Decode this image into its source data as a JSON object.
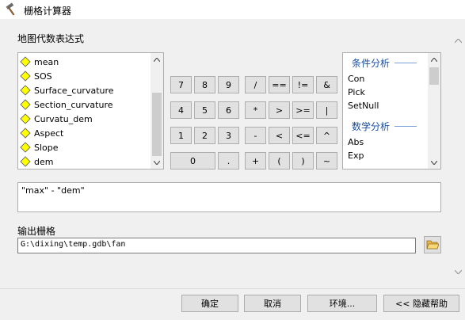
{
  "window": {
    "title": "栅格计算器",
    "icon": "hammer-icon"
  },
  "map_algebra": {
    "label": "地图代数表达式",
    "layers": [
      {
        "name": "mean",
        "icon": "raster-layer-icon"
      },
      {
        "name": "SOS",
        "icon": "raster-layer-icon"
      },
      {
        "name": "Surface_curvature",
        "icon": "raster-layer-icon"
      },
      {
        "name": "Section_curvature",
        "icon": "raster-layer-icon"
      },
      {
        "name": "Curvatu_dem",
        "icon": "raster-layer-icon"
      },
      {
        "name": "Aspect",
        "icon": "raster-layer-icon"
      },
      {
        "name": "Slope",
        "icon": "raster-layer-icon"
      },
      {
        "name": "dem",
        "icon": "raster-layer-icon"
      }
    ],
    "keypad": {
      "row1": [
        "7",
        "8",
        "9",
        "/",
        "==",
        "!=",
        "&"
      ],
      "row2": [
        "4",
        "5",
        "6",
        "*",
        ">",
        ">=",
        "|"
      ],
      "row3": [
        "1",
        "2",
        "3",
        "-",
        "<",
        "<=",
        "^"
      ],
      "row4": [
        "0",
        ".",
        "+",
        "(",
        ")",
        "~"
      ]
    },
    "functions": {
      "groups": [
        {
          "heading": "条件分析",
          "items": [
            "Con",
            "Pick",
            "SetNull"
          ]
        },
        {
          "heading": "数学分析",
          "items": [
            "Abs",
            "Exp"
          ]
        }
      ]
    },
    "expression": "\"max\" - \"dem\""
  },
  "output": {
    "label": "输出栅格",
    "value": "G:\\dixing\\temp.gdb\\fan",
    "browse_icon": "folder-open-icon"
  },
  "buttons": {
    "ok": "确定",
    "cancel": "取消",
    "environments": "环境...",
    "hide_help": "<< 隐藏帮助"
  },
  "colors": {
    "layer_icon_fill": "#ffff00",
    "heading_color": "#1a4fa0",
    "background": "#f0f0f0"
  }
}
